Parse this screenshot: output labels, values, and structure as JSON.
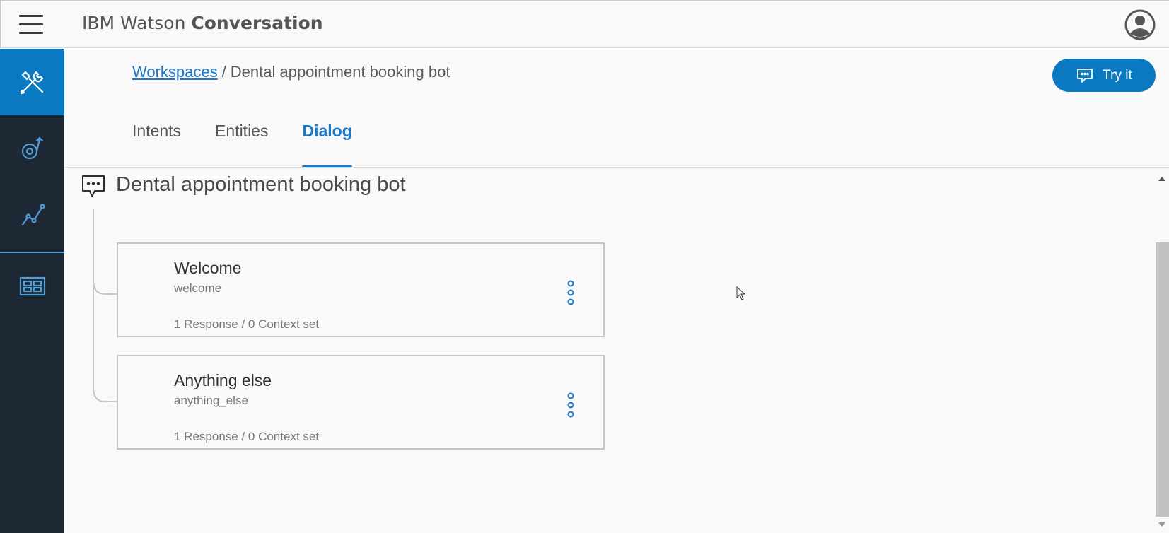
{
  "header": {
    "brand_light": "IBM Watson ",
    "brand_bold": "Conversation",
    "menu_icon": "hamburger-menu-icon",
    "user_icon": "user-avatar-icon"
  },
  "sidebar": {
    "items": [
      {
        "icon": "build-tools-icon",
        "active": true
      },
      {
        "icon": "improve-icon",
        "active": false
      },
      {
        "icon": "analytics-line-icon",
        "active": false
      },
      {
        "icon": "deploy-grid-icon",
        "active": false
      }
    ]
  },
  "breadcrumb": {
    "root": "Workspaces",
    "separator": "/",
    "current": "Dental appointment booking bot"
  },
  "try_button": {
    "label": "Try it",
    "icon": "chat-bubble-icon"
  },
  "tabs": [
    {
      "label": "Intents",
      "active": false
    },
    {
      "label": "Entities",
      "active": false
    },
    {
      "label": "Dialog",
      "active": true
    }
  ],
  "dialog": {
    "title": "Dental appointment booking bot",
    "nodes": [
      {
        "name": "Welcome",
        "condition": "welcome",
        "summary": "1 Response / 0 Context set"
      },
      {
        "name": "Anything else",
        "condition": "anything_else",
        "summary": "1 Response / 0 Context set"
      }
    ]
  },
  "colors": {
    "accent": "#0b78c2",
    "sidebar_bg": "#1d2834",
    "link": "#1a77c9"
  }
}
